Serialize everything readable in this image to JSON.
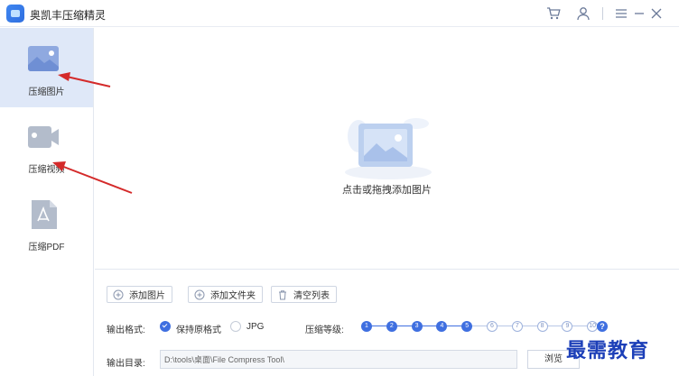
{
  "app": {
    "title": "奥凯丰压缩精灵"
  },
  "sidebar": {
    "items": [
      {
        "label": "压缩图片",
        "active": true,
        "icon": "image-icon"
      },
      {
        "label": "压缩视频",
        "active": false,
        "icon": "video-icon"
      },
      {
        "label": "压缩PDF",
        "active": false,
        "icon": "pdf-icon"
      }
    ]
  },
  "dropzone": {
    "text": "点击或拖拽添加图片"
  },
  "toolbar": {
    "add_image": "添加图片",
    "add_folder": "添加文件夹",
    "clear_list": "清空列表"
  },
  "output_format": {
    "label": "输出格式:",
    "options": [
      "保持原格式",
      "JPG"
    ],
    "selected": "保持原格式"
  },
  "compression_level": {
    "label": "压缩等级:",
    "levels": [
      "1",
      "2",
      "3",
      "4",
      "5",
      "6",
      "7",
      "8",
      "9",
      "10"
    ],
    "selected": 5
  },
  "output_dir": {
    "label": "输出目录:",
    "value": "D:\\tools\\桌面\\File Compress Tool\\",
    "browse": "浏览"
  },
  "watermark": "最需教育",
  "colors": {
    "accent": "#3f6fe0",
    "active_nav": "#dfe8f8",
    "arrow": "#d42a2a"
  }
}
